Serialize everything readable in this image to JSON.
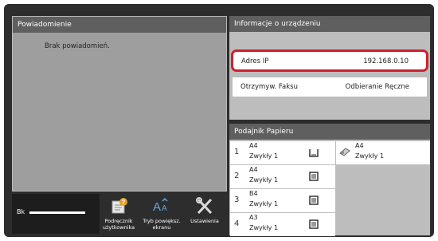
{
  "notification": {
    "title": "Powiadomienie",
    "message": "Brak powiadomień."
  },
  "toner": {
    "label": "Bk",
    "level_percent": 100
  },
  "quick_buttons": [
    {
      "label_line1": "Podręcznik",
      "label_line2": "użytkownika",
      "icon": "manual-icon"
    },
    {
      "label_line1": "Tryb powiększ.",
      "label_line2": "ekranu",
      "icon": "magnify-text-icon"
    },
    {
      "label_line1": "Ustawienia",
      "label_line2": "",
      "icon": "tools-icon"
    }
  ],
  "device_info": {
    "title": "Informacje o urządzeniu",
    "rows": [
      {
        "key": "Adres IP",
        "value": "192.168.0.10",
        "highlighted": true
      },
      {
        "key": "Otrzymyw. Faksu",
        "value": "Odbieranie Ręczne"
      }
    ],
    "highlight_color": "#d0202e"
  },
  "paper_tray": {
    "title": "Podajnik Papieru",
    "trays": [
      {
        "number": "1",
        "size": "A4",
        "type": "Zwykły 1",
        "icon": "tray-open-icon"
      },
      {
        "number": "2",
        "size": "A4",
        "type": "Zwykły 1",
        "icon": "tray-stack-icon"
      },
      {
        "number": "3",
        "size": "B4",
        "type": "Zwykły 1",
        "icon": "tray-stack-icon"
      },
      {
        "number": "4",
        "size": "A3",
        "type": "Zwykły 1",
        "icon": "tray-stack-icon"
      }
    ],
    "bypass": {
      "size": "A4",
      "type": "Zwykły 1",
      "icon": "bypass-tray-icon"
    }
  }
}
